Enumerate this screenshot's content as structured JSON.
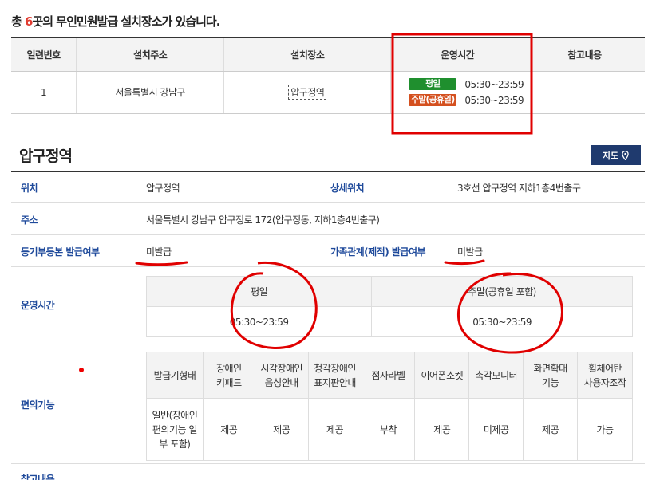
{
  "summary": {
    "prefix": "총 ",
    "count": "6",
    "suffix": "곳의 무인민원발급 설치장소가 있습니다."
  },
  "top_table": {
    "headers": [
      "일련번호",
      "설치주소",
      "설치장소",
      "운영시간",
      "참고내용"
    ],
    "row": {
      "no": "1",
      "address": "서울특별시 강남구",
      "place": "압구정역",
      "weekday_badge": "평일",
      "weekday_hours": "05:30~23:59",
      "weekend_badge": "주말(공휴일)",
      "weekend_hours": "05:30~23:59",
      "note": ""
    }
  },
  "detail": {
    "title": "압구정역",
    "map_button": "지도",
    "location_label": "위치",
    "location_value": "압구정역",
    "detail_location_label": "상세위치",
    "detail_location_value": "3호선 압구정역 지하1층4번출구",
    "address_label": "주소",
    "address_value": "서울특별시 강남구 압구정로 172(압구정동, 지하1층4번출구)",
    "registry_label": "등기부등본 발급여부",
    "registry_value": "미발급",
    "family_label": "가족관계(제적) 발급여부",
    "family_value": "미발급",
    "hours_label": "운영시간",
    "hours": {
      "weekday_header": "평일",
      "weekend_header": "주말(공휴일 포함)",
      "weekday_value": "05:30~23:59",
      "weekend_value": "05:30~23:59"
    },
    "convenience_label": "편의기능",
    "convenience": {
      "headers": [
        [
          "발급기형태"
        ],
        [
          "장애인",
          "키패드"
        ],
        [
          "시각장애인",
          "음성안내"
        ],
        [
          "청각장애인",
          "표지판안내"
        ],
        [
          "점자라벨"
        ],
        [
          "이어폰소켓"
        ],
        [
          "촉각모니터"
        ],
        [
          "화면확대",
          "기능"
        ],
        [
          "휠체어탄",
          "사용자조작"
        ]
      ],
      "values": [
        [
          "일반(장애인",
          "편의기능 일",
          "부 포함)"
        ],
        [
          "제공"
        ],
        [
          "제공"
        ],
        [
          "제공"
        ],
        [
          "부착"
        ],
        [
          "제공"
        ],
        [
          "미제공"
        ],
        [
          "제공"
        ],
        [
          "가능"
        ]
      ]
    },
    "note_label": "참고내용"
  },
  "colors": {
    "accent_blue": "#1f4a9b",
    "badge_green": "#1f8f2e",
    "badge_orange": "#d4501f",
    "annotation_red": "#e00000",
    "map_button": "#1f3a6e"
  },
  "icons": {
    "map_button_icon": "map-pin-icon"
  }
}
